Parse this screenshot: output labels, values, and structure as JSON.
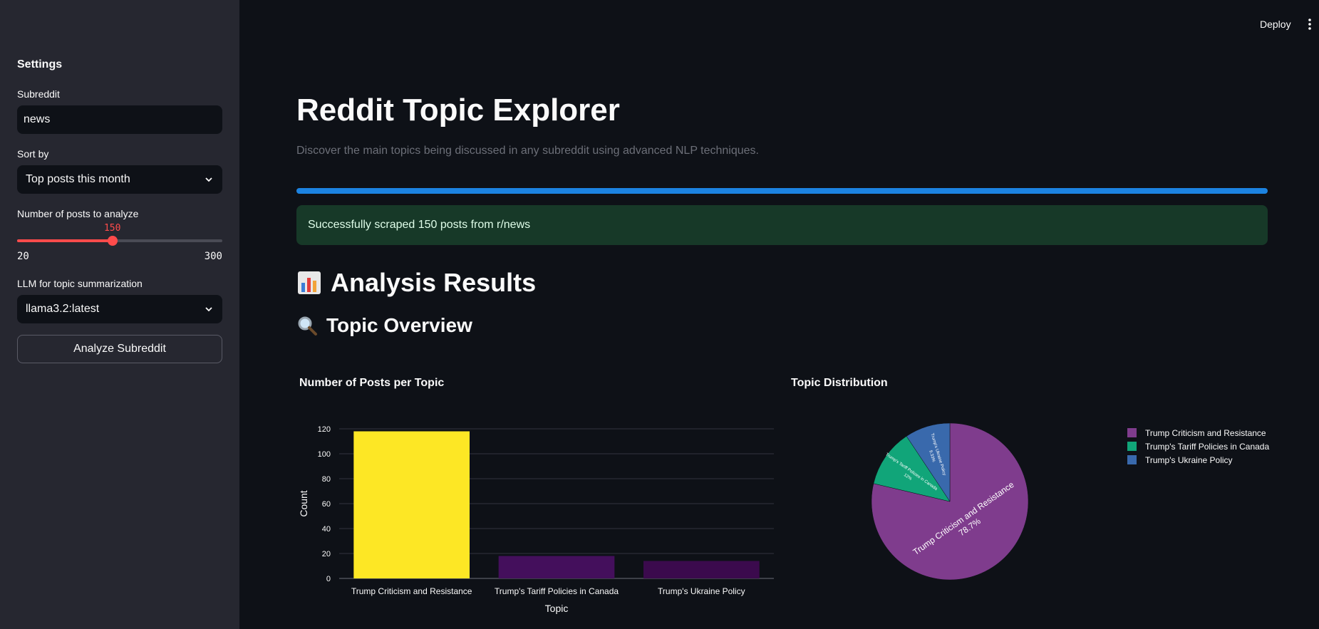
{
  "header": {
    "deploy_label": "Deploy",
    "menu_icon": "kebab-menu-icon"
  },
  "sidebar": {
    "title": "Settings",
    "subreddit": {
      "label": "Subreddit",
      "value": "news"
    },
    "sort": {
      "label": "Sort by",
      "value": "Top posts this month"
    },
    "posts": {
      "label": "Number of posts to analyze",
      "value": 150,
      "value_label": "150",
      "min": "20",
      "max": "300",
      "min_value": 20,
      "max_value": 300
    },
    "llm": {
      "label": "LLM for topic summarization",
      "value": "llama3.2:latest"
    },
    "analyze_button": "Analyze Subreddit"
  },
  "main": {
    "title": "Reddit Topic Explorer",
    "subtitle": "Discover the main topics being discussed in any subreddit using advanced NLP techniques.",
    "progress": 1.0,
    "success_message": "Successfully scraped 150 posts from r/news",
    "results_heading": "Analysis Results",
    "overview_heading": "Topic Overview",
    "bar_chart_title": "Number of Posts per Topic",
    "pie_chart_title": "Topic Distribution"
  },
  "colors": {
    "accent": "#ff4b4b",
    "progress": "#1c83e1",
    "success_bg": "#173928"
  },
  "chart_data": [
    {
      "type": "bar",
      "title": "Number of Posts per Topic",
      "categories": [
        "Trump Criticism and Resistance",
        "Trump's Tariff Policies in Canada",
        "Trump's Ukraine Policy"
      ],
      "values": [
        118,
        18,
        14
      ],
      "colors": [
        "#fde725",
        "#440f5c",
        "#3b0a4d"
      ],
      "xlabel": "Topic",
      "ylabel": "Count",
      "ylim": [
        0,
        120
      ],
      "yticks": [
        0,
        20,
        40,
        60,
        80,
        100,
        120
      ],
      "grid": true
    },
    {
      "type": "pie",
      "title": "Topic Distribution",
      "labels": [
        "Trump Criticism and Resistance",
        "Trump's Tariff Policies in Canada",
        "Trump's Ukraine Policy"
      ],
      "values": [
        78.7,
        12,
        9.33
      ],
      "percent_labels": [
        "78.7%",
        "12%",
        "9.33%"
      ],
      "colors": [
        "#7f3c8d",
        "#11a579",
        "#3969ac"
      ],
      "legend": "right"
    }
  ]
}
